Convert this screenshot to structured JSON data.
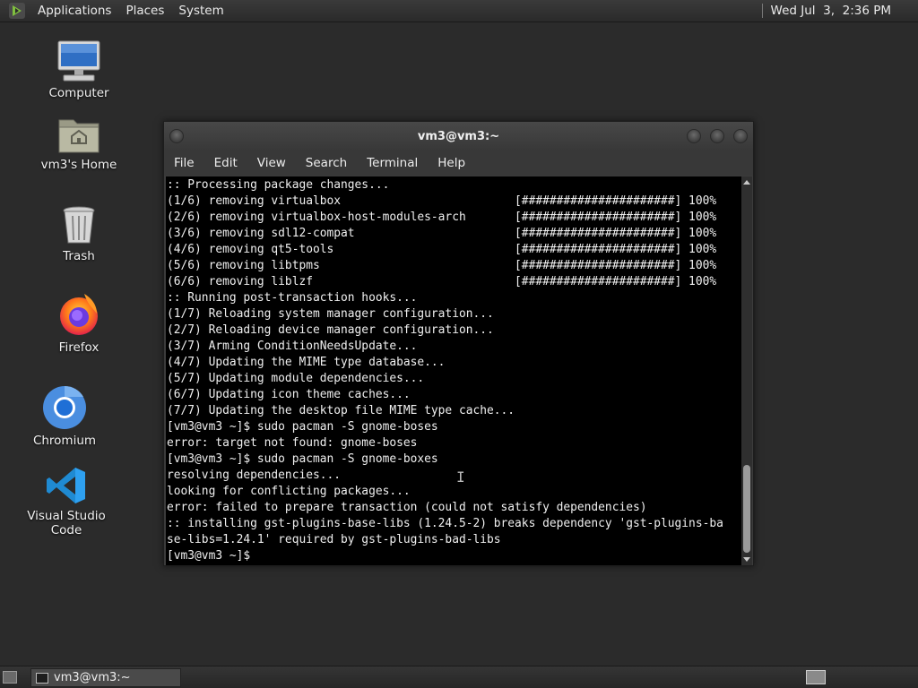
{
  "top_panel": {
    "menus": [
      "Applications",
      "Places",
      "System"
    ],
    "clock": "Wed Jul  3,  2:36 PM"
  },
  "desktop": {
    "icons": [
      {
        "label": "Computer",
        "icon": "computer-icon"
      },
      {
        "label": "vm3's Home",
        "icon": "home-folder-icon"
      },
      {
        "label": "Trash",
        "icon": "trash-icon"
      },
      {
        "label": "Firefox",
        "icon": "firefox-icon"
      },
      {
        "label": "Chromium",
        "icon": "chromium-icon"
      },
      {
        "label": "Visual Studio Code",
        "icon": "vscode-icon"
      }
    ]
  },
  "terminal": {
    "title": "vm3@vm3:~",
    "menu": [
      "File",
      "Edit",
      "View",
      "Search",
      "Terminal",
      "Help"
    ],
    "lines": [
      ":: Processing package changes...",
      "(1/6) removing virtualbox                         [######################] 100%",
      "(2/6) removing virtualbox-host-modules-arch       [######################] 100%",
      "(3/6) removing sdl12-compat                       [######################] 100%",
      "(4/6) removing qt5-tools                          [######################] 100%",
      "(5/6) removing libtpms                            [######################] 100%",
      "(6/6) removing liblzf                             [######################] 100%",
      ":: Running post-transaction hooks...",
      "(1/7) Reloading system manager configuration...",
      "(2/7) Reloading device manager configuration...",
      "(3/7) Arming ConditionNeedsUpdate...",
      "(4/7) Updating the MIME type database...",
      "(5/7) Updating module dependencies...",
      "(6/7) Updating icon theme caches...",
      "(7/7) Updating the desktop file MIME type cache...",
      "[vm3@vm3 ~]$ sudo pacman -S gnome-boses",
      "error: target not found: gnome-boses",
      "[vm3@vm3 ~]$ sudo pacman -S gnome-boxes",
      "resolving dependencies...",
      "looking for conflicting packages...",
      "error: failed to prepare transaction (could not satisfy dependencies)",
      ":: installing gst-plugins-base-libs (1.24.5-2) breaks dependency 'gst-plugins-ba",
      "se-libs=1.24.1' required by gst-plugins-bad-libs",
      "[vm3@vm3 ~]$ "
    ]
  },
  "bottom_panel": {
    "task_label": "vm3@vm3:~"
  },
  "colors": {
    "desktop_bg": "#2b2b2b",
    "terminal_bg": "#000000",
    "terminal_fg": "#f0f0f0",
    "panel_bg": "#2e2e2e"
  }
}
